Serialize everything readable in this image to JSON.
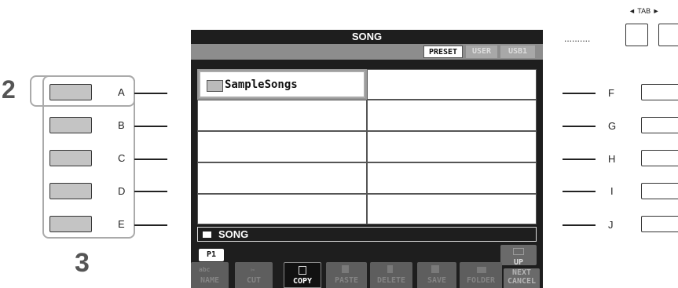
{
  "step_numbers": {
    "select": "2",
    "navigate": "3"
  },
  "left_buttons": [
    {
      "letter": "A"
    },
    {
      "letter": "B"
    },
    {
      "letter": "C"
    },
    {
      "letter": "D"
    },
    {
      "letter": "E"
    }
  ],
  "right_buttons": [
    {
      "letter": "F"
    },
    {
      "letter": "G"
    },
    {
      "letter": "H"
    },
    {
      "letter": "I"
    },
    {
      "letter": "J"
    }
  ],
  "tab_control": {
    "label": "TAB",
    "left_arrow": "◄",
    "right_arrow": "►"
  },
  "dots": "..........",
  "screen": {
    "title": "SONG",
    "tabs": [
      {
        "label": "PRESET",
        "active": true
      },
      {
        "label": "USER",
        "active": false
      },
      {
        "label": "USB1",
        "active": false
      }
    ],
    "grid": [
      {
        "label": "SampleSongs",
        "icon": "folder-icon",
        "selected": true
      },
      {
        "label": ""
      },
      {
        "label": ""
      },
      {
        "label": ""
      },
      {
        "label": ""
      },
      {
        "label": ""
      },
      {
        "label": ""
      },
      {
        "label": ""
      },
      {
        "label": ""
      },
      {
        "label": ""
      }
    ],
    "current_path": "SONG",
    "page_tab": "P1",
    "up_button": "UP",
    "function_buttons": [
      {
        "label": "NAME",
        "sublabel": "abc",
        "active": false
      },
      {
        "label": "CUT",
        "active": false
      },
      {
        "label": "COPY",
        "active": true
      },
      {
        "label": "PASTE",
        "active": false
      },
      {
        "label": "DELETE",
        "active": false
      },
      {
        "label": "SAVE",
        "active": false
      },
      {
        "label": "FOLDER",
        "active": false
      },
      {
        "label": "NEXT",
        "label2": "CANCEL",
        "active": false
      }
    ],
    "colors": {
      "screen_bg": "#1e1e1e",
      "tab_bar": "#8d8d8d",
      "active_button": "#111111",
      "inactive_button": "#5e5e5e"
    }
  }
}
